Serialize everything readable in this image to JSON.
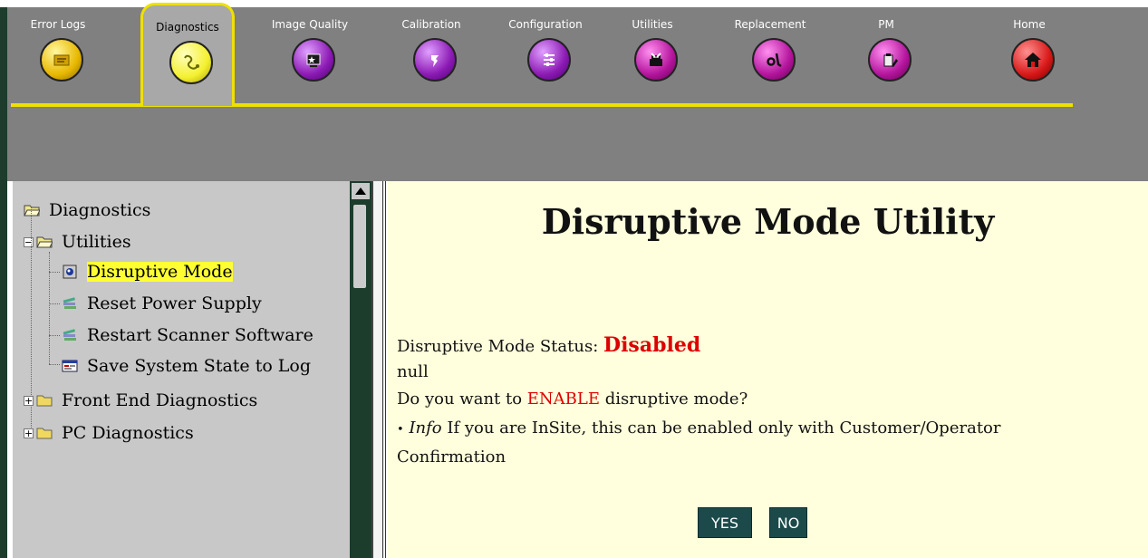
{
  "tabs": [
    {
      "label": "Error Logs",
      "icon": "error-log-icon",
      "color": "#e8b800",
      "active": false
    },
    {
      "label": "Diagnostics",
      "icon": "diagnostics-icon",
      "color": "#f4f030",
      "active": true
    },
    {
      "label": "Image Quality",
      "icon": "image-quality-icon",
      "color": "#8c1ab4",
      "active": false
    },
    {
      "label": "Calibration",
      "icon": "calibration-icon",
      "color": "#8c1ab4",
      "active": false
    },
    {
      "label": "Configuration",
      "icon": "configuration-icon",
      "color": "#8c1ab4",
      "active": false
    },
    {
      "label": "Utilities",
      "icon": "utilities-icon",
      "color": "#b4149c",
      "active": false
    },
    {
      "label": "Replacement",
      "icon": "replacement-icon",
      "color": "#b4149c",
      "active": false
    },
    {
      "label": "PM",
      "icon": "pm-icon",
      "color": "#b4149c",
      "active": false
    },
    {
      "label": "Home",
      "icon": "home-icon",
      "color": "#d81818",
      "active": false
    }
  ],
  "tree": {
    "root": "Diagnostics",
    "utilities": "Utilities",
    "items": [
      "Disruptive Mode",
      "Reset Power Supply",
      "Restart Scanner Software",
      "Save System State to Log"
    ],
    "selected": "Disruptive Mode",
    "front_end": "Front End Diagnostics",
    "pc": "PC Diagnostics"
  },
  "content": {
    "title": "Disruptive Mode Utility",
    "status_label": "Disruptive Mode Status: ",
    "status_value": "Disabled",
    "null_text": "null",
    "question_pre": "Do you want to ",
    "question_emph": "ENABLE",
    "question_post": " disruptive mode?",
    "info_bullet": "•",
    "info_label": "Info",
    "info_text": " If you are InSite, this can be enabled only with Customer/Operator",
    "info_text2": "Confirmation",
    "yes_label": "YES",
    "no_label": "NO"
  },
  "colors": {
    "toolbar_bg": "#808080",
    "highlight": "#eee000",
    "content_bg": "#ffffdd",
    "alert_red": "#dd0000",
    "button_bg": "#1c4a4a"
  }
}
